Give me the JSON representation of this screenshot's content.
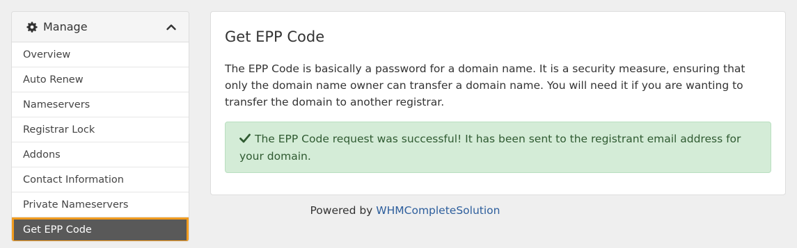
{
  "sidebar": {
    "header_title": "Manage",
    "header_icon": "gear-icon",
    "collapse_icon": "chevron-up-icon",
    "items": [
      {
        "label": "Overview"
      },
      {
        "label": "Auto Renew"
      },
      {
        "label": "Nameservers"
      },
      {
        "label": "Registrar Lock"
      },
      {
        "label": "Addons"
      },
      {
        "label": "Contact Information"
      },
      {
        "label": "Private Nameservers"
      },
      {
        "label": "Get EPP Code",
        "active": true
      }
    ],
    "active_highlight_color": "#f29c1f"
  },
  "main": {
    "title": "Get EPP Code",
    "description": "The EPP Code is basically a password for a domain name. It is a security measure, ensuring that only the domain name owner can transfer a domain name. You will need it if you are wanting to transfer the domain to another registrar.",
    "alert": {
      "icon": "check-icon",
      "message": "The EPP Code request was successful! It has been sent to the registrant email address for your domain.",
      "color": "#d4ecd7"
    }
  },
  "footer": {
    "prefix": "Powered by ",
    "link_text": "WHMCompleteSolution"
  }
}
